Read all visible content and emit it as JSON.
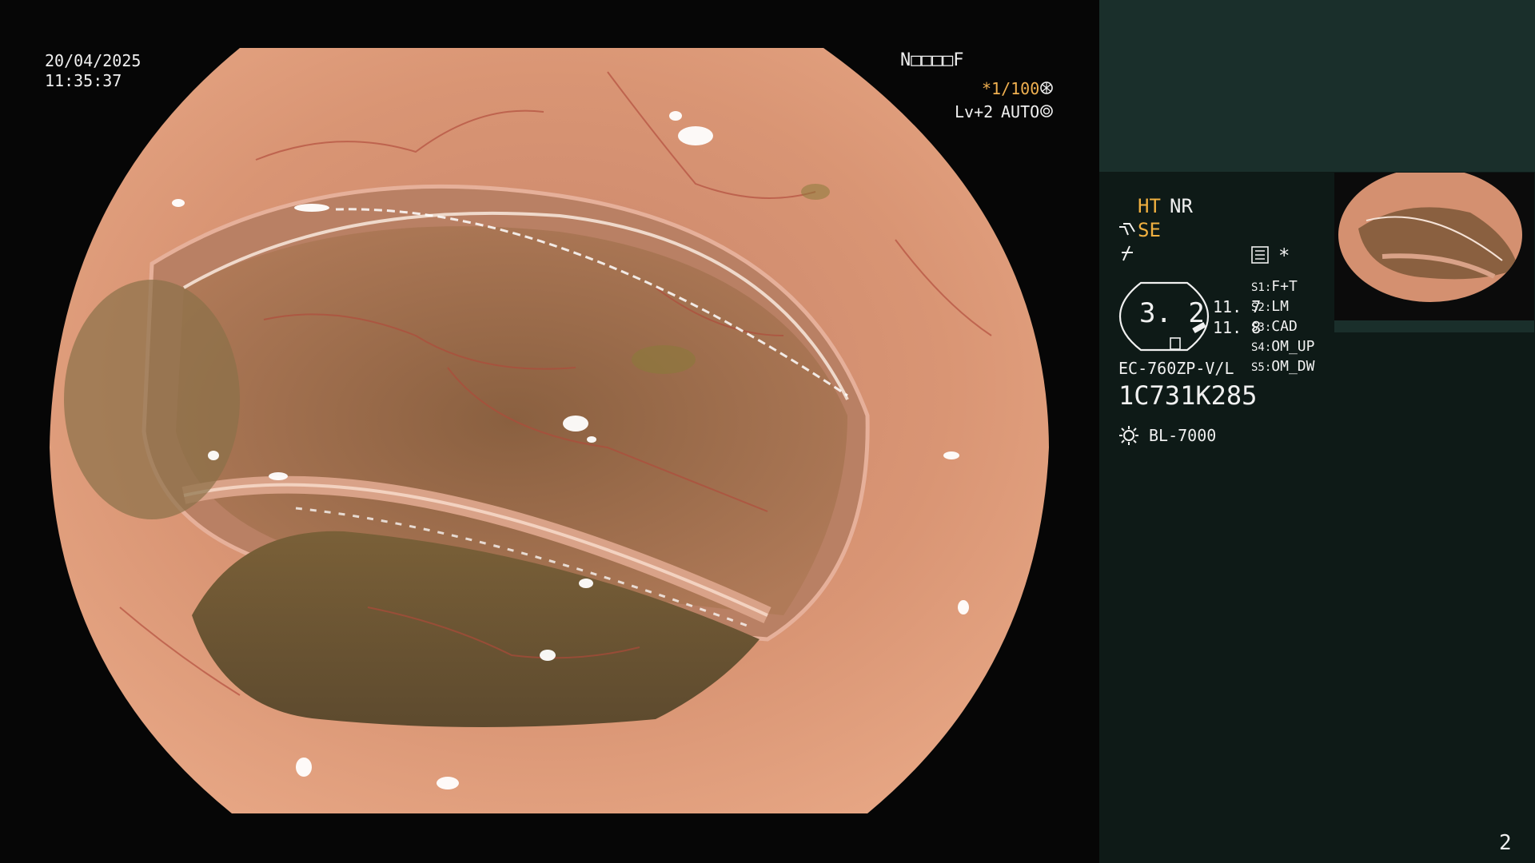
{
  "osd": {
    "date": "20/04/2025",
    "time": "11:35:37",
    "mode_code": "N□□□□F",
    "shutter": "*1/100",
    "shutter_icon": "aperture-icon",
    "level": "Lv+2",
    "exposure_mode": "AUTO",
    "exposure_icon": "target-icon"
  },
  "panel": {
    "ht": "HT",
    "nr": "NR",
    "se": "SE",
    "scope_value": "3. 2",
    "value_top": "11. 7",
    "value_bottom": "11. 8",
    "switches": [
      {
        "key": "S1",
        "value": "F+T"
      },
      {
        "key": "S2",
        "value": "LM"
      },
      {
        "key": "S3",
        "value": "CAD"
      },
      {
        "key": "S4",
        "value": "OM_UP"
      },
      {
        "key": "S5",
        "value": "OM_DW"
      }
    ],
    "scope_model": "EC-760ZP-V/L",
    "serial": "1C731K285",
    "light_source": "BL-7000",
    "star": "*",
    "page_number": "2"
  },
  "colors": {
    "accent_orange": "#f0b040",
    "panel_bg": "#0e1a17",
    "panel_top_bg": "#1a2f2b",
    "tissue": "#d8906c"
  }
}
